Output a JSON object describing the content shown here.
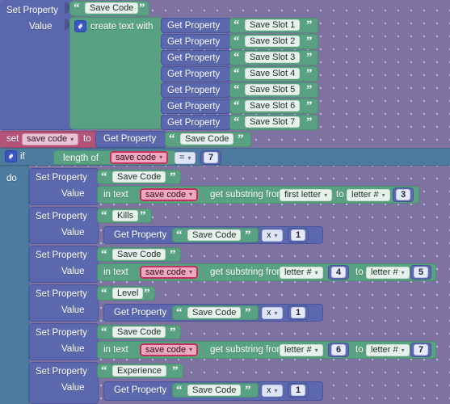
{
  "editor": {
    "name": "blockly-workspace",
    "colors": {
      "background": "#7e72a0",
      "grid_dot": "#c9c3dd",
      "block_blue": "#5b68ad",
      "block_green": "#58a283",
      "block_control": "#4d7ba0",
      "block_set_variable": "#b4537a",
      "variable_field": "#f0a7c2",
      "number_field": "#e6e9f7"
    }
  },
  "top_block": {
    "statement_label": "Set Property",
    "value_label": "Value",
    "property_text": "Save Code",
    "create_text_with": "create text with",
    "gear_icon": "gear-icon",
    "items": [
      {
        "get_property": "Get Property",
        "text": "Save Slot 1"
      },
      {
        "get_property": "Get Property",
        "text": "Save Slot 2"
      },
      {
        "get_property": "Get Property",
        "text": "Save Slot 3"
      },
      {
        "get_property": "Get Property",
        "text": "Save Slot 4"
      },
      {
        "get_property": "Get Property",
        "text": "Save Slot 5"
      },
      {
        "get_property": "Get Property",
        "text": "Save Slot 6"
      },
      {
        "get_property": "Get Property",
        "text": "Save Slot 7"
      }
    ]
  },
  "set_variable_block": {
    "set_label": "set",
    "variable": "save code",
    "to_label": "to",
    "get_property": "Get Property",
    "property_text": "Save Code"
  },
  "if_block": {
    "gear_icon": "gear-icon",
    "if_label": "if",
    "do_label": "do",
    "condition": {
      "length_of": "length of",
      "variable": "save code",
      "operator": "=",
      "value": "7"
    }
  },
  "do_rows": [
    {
      "statement_label": "Set Property",
      "value_label": "Value",
      "property_text": "Save Code",
      "kind": "substring",
      "in_text": "in text",
      "variable": "save code",
      "get_substring_from": "get substring from",
      "from_mode": "first letter",
      "from_value": "",
      "to_label": "to",
      "to_mode": "letter #",
      "to_value": "3"
    },
    {
      "statement_label": "Set Property",
      "value_label": "Value",
      "property_text": "Kills",
      "kind": "getproperty",
      "get_property": "Get Property",
      "gp_text": "Save Code",
      "operator": "x",
      "operand": "1"
    },
    {
      "statement_label": "Set Property",
      "value_label": "Value",
      "property_text": "Save Code",
      "kind": "substring",
      "in_text": "in text",
      "variable": "save code",
      "get_substring_from": "get substring from",
      "from_mode": "letter #",
      "from_value": "4",
      "to_label": "to",
      "to_mode": "letter #",
      "to_value": "5"
    },
    {
      "statement_label": "Set Property",
      "value_label": "Value",
      "property_text": "Level",
      "kind": "getproperty",
      "get_property": "Get Property",
      "gp_text": "Save Code",
      "operator": "x",
      "operand": "1"
    },
    {
      "statement_label": "Set Property",
      "value_label": "Value",
      "property_text": "Save Code",
      "kind": "substring",
      "in_text": "in text",
      "variable": "save code",
      "get_substring_from": "get substring from",
      "from_mode": "letter #",
      "from_value": "6",
      "to_label": "to",
      "to_mode": "letter #",
      "to_value": "7"
    },
    {
      "statement_label": "Set Property",
      "value_label": "Value",
      "property_text": "Experience",
      "kind": "getproperty",
      "get_property": "Get Property",
      "gp_text": "Save Code",
      "operator": "x",
      "operand": "1"
    }
  ],
  "glyphs": {
    "open_quote": "“",
    "close_quote": "”",
    "caret_down": "▾"
  }
}
